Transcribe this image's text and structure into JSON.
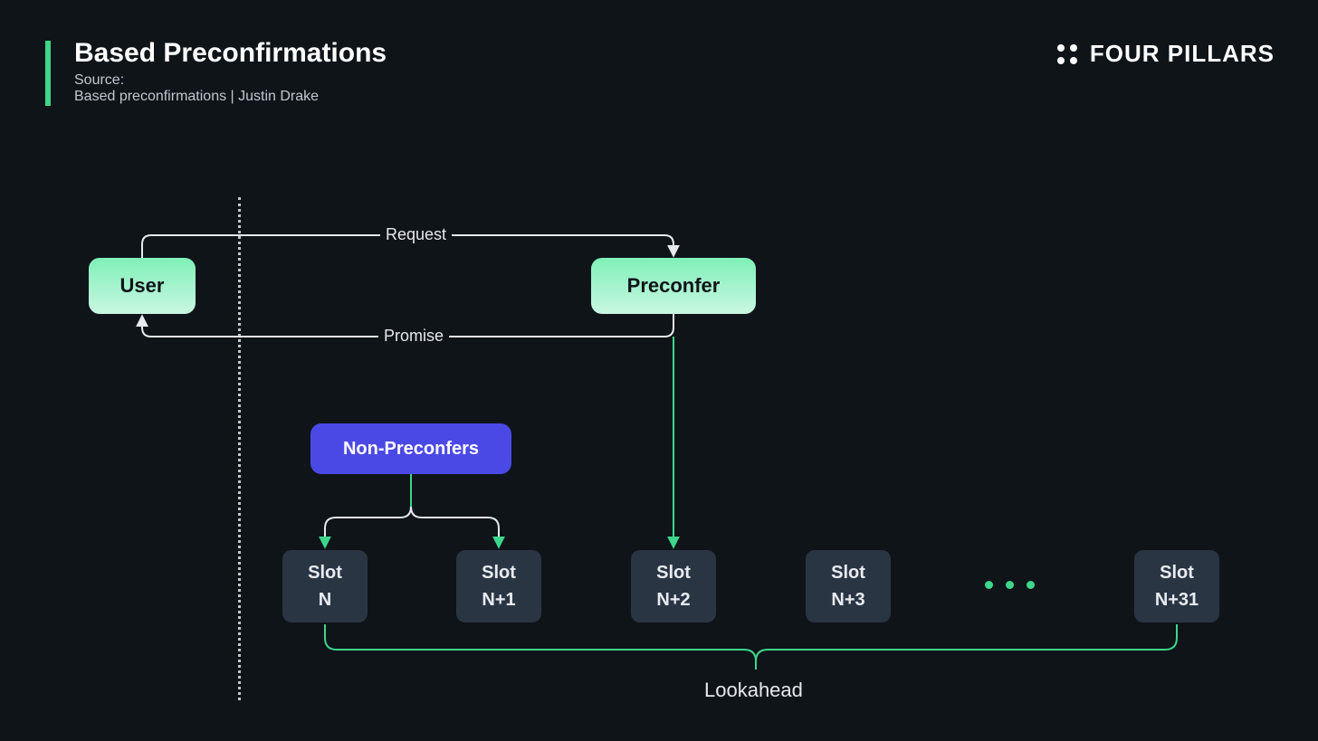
{
  "header": {
    "title": "Based Preconfirmations",
    "source_label": "Source:",
    "source_citation": "Based preconfirmations | Justin Drake",
    "brand": "FOUR PILLARS"
  },
  "nodes": {
    "user": "User",
    "preconfer": "Preconfer",
    "non_preconfers": "Non-Preconfers"
  },
  "edges": {
    "request": "Request",
    "promise": "Promise",
    "lookahead": "Lookahead"
  },
  "slots": [
    {
      "line1": "Slot",
      "line2": "N"
    },
    {
      "line1": "Slot",
      "line2": "N+1"
    },
    {
      "line1": "Slot",
      "line2": "N+2"
    },
    {
      "line1": "Slot",
      "line2": "N+3"
    },
    {
      "line1": "Slot",
      "line2": "N+31"
    }
  ],
  "colors": {
    "background": "#0f1419",
    "accent_green": "#3dd68c",
    "node_green_top": "#7ff0b8",
    "node_green_bottom": "#c9f7e1",
    "node_blue": "#4b49e6",
    "slot_bg": "#2a3544",
    "text_light": "#e6e9ed"
  }
}
